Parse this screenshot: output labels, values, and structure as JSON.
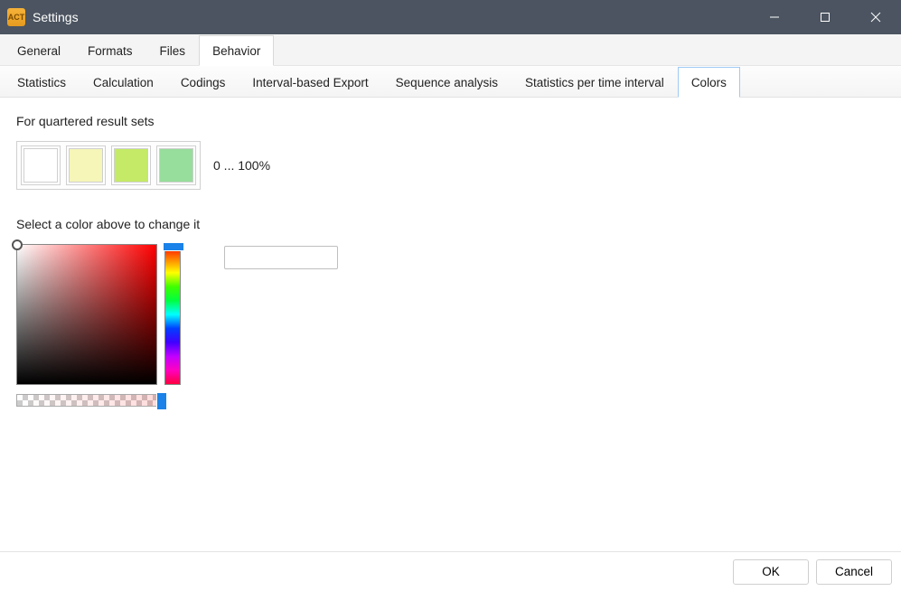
{
  "window": {
    "title": "Settings",
    "app_icon_text": "ACT"
  },
  "outer_tabs": [
    {
      "label": "General",
      "active": false
    },
    {
      "label": "Formats",
      "active": false
    },
    {
      "label": "Files",
      "active": false
    },
    {
      "label": "Behavior",
      "active": true
    }
  ],
  "inner_tabs": [
    {
      "label": "Statistics",
      "active": false
    },
    {
      "label": "Calculation",
      "active": false
    },
    {
      "label": "Codings",
      "active": false
    },
    {
      "label": "Interval-based Export",
      "active": false
    },
    {
      "label": "Sequence analysis",
      "active": false
    },
    {
      "label": "Statistics per time interval",
      "active": false
    },
    {
      "label": "Colors",
      "active": true
    }
  ],
  "colors_panel": {
    "quartered_label": "For quartered result sets",
    "select_hint": "Select a color above to change it",
    "range_text": "0 ... 100%",
    "swatches": [
      {
        "color": "#ffffff"
      },
      {
        "color": "#f5f6b8"
      },
      {
        "color": "#c4ea67"
      },
      {
        "color": "#97dd9c"
      }
    ],
    "preview_color": "#ffffff"
  },
  "footer": {
    "ok": "OK",
    "cancel": "Cancel"
  }
}
